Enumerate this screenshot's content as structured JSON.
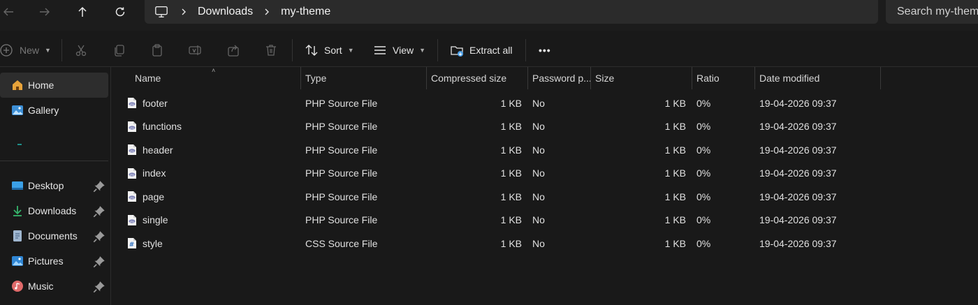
{
  "breadcrumbs": [
    {
      "label": "Downloads"
    },
    {
      "label": "my-theme"
    }
  ],
  "search": {
    "placeholder": "Search my-theme"
  },
  "toolbar": {
    "new_label": "New",
    "sort_label": "Sort",
    "view_label": "View",
    "extract_label": "Extract all",
    "more_label": "•••"
  },
  "sidebar": {
    "items": [
      {
        "label": "Home"
      },
      {
        "label": "Gallery"
      },
      {
        "label": "Desktop"
      },
      {
        "label": "Downloads"
      },
      {
        "label": "Documents"
      },
      {
        "label": "Pictures"
      },
      {
        "label": "Music"
      }
    ]
  },
  "columns": [
    "Name",
    "Type",
    "Compressed size",
    "Password p...",
    "Size",
    "Ratio",
    "Date modified"
  ],
  "files": [
    {
      "name": "footer",
      "type": "PHP Source File",
      "compressed": "1 KB",
      "password": "No",
      "size": "1 KB",
      "ratio": "0%",
      "modified": "19-04-2026 09:37",
      "icon": "php-file-icon"
    },
    {
      "name": "functions",
      "type": "PHP Source File",
      "compressed": "1 KB",
      "password": "No",
      "size": "1 KB",
      "ratio": "0%",
      "modified": "19-04-2026 09:37",
      "icon": "php-file-icon"
    },
    {
      "name": "header",
      "type": "PHP Source File",
      "compressed": "1 KB",
      "password": "No",
      "size": "1 KB",
      "ratio": "0%",
      "modified": "19-04-2026 09:37",
      "icon": "php-file-icon"
    },
    {
      "name": "index",
      "type": "PHP Source File",
      "compressed": "1 KB",
      "password": "No",
      "size": "1 KB",
      "ratio": "0%",
      "modified": "19-04-2026 09:37",
      "icon": "php-file-icon"
    },
    {
      "name": "page",
      "type": "PHP Source File",
      "compressed": "1 KB",
      "password": "No",
      "size": "1 KB",
      "ratio": "0%",
      "modified": "19-04-2026 09:37",
      "icon": "php-file-icon"
    },
    {
      "name": "single",
      "type": "PHP Source File",
      "compressed": "1 KB",
      "password": "No",
      "size": "1 KB",
      "ratio": "0%",
      "modified": "19-04-2026 09:37",
      "icon": "php-file-icon"
    },
    {
      "name": "style",
      "type": "CSS Source File",
      "compressed": "1 KB",
      "password": "No",
      "size": "1 KB",
      "ratio": "0%",
      "modified": "19-04-2026 09:37",
      "icon": "css-file-icon"
    }
  ],
  "colors": {
    "background": "#191919",
    "accent": "#4a9fe8",
    "php": "#7b7fb5"
  }
}
